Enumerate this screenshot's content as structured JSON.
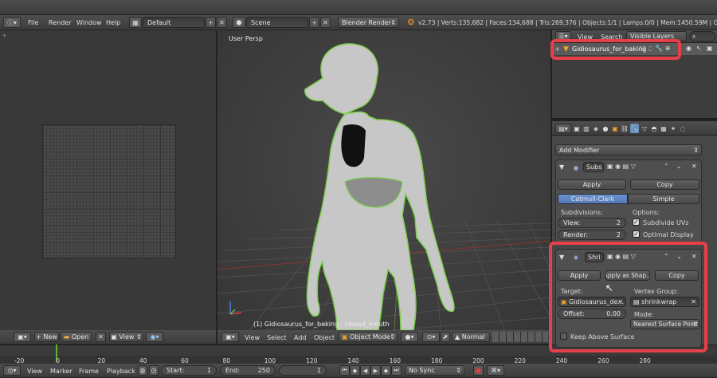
{
  "topbar": {
    "menus": [
      "File",
      "Render",
      "Window",
      "Help"
    ],
    "layout": "Default",
    "scene": "Scene",
    "engine": "Blender Render",
    "stats": "v2.73 | Verts:135,682 | Faces:134,688 | Tris:269,376 | Objects:1/1 | Lamps:0/0 | Mem:1450.59M | Gidiosaurus_"
  },
  "uv_editor": {
    "new_label": "New",
    "open_label": "Open",
    "view_label": "View"
  },
  "viewport": {
    "view_name": "User Persp",
    "object_info": "(1) Gidiosaurus_for_baking : closed_mouth",
    "menus": [
      "View",
      "Select",
      "Add",
      "Object"
    ],
    "mode": "Object Mode",
    "shading": "Normal"
  },
  "outliner": {
    "view_label": "View",
    "search_label": "Search",
    "filter": "Visible Layers",
    "object_name": "Gidiosaurus_for_baking"
  },
  "modifiers": {
    "add_modifier": "Add Modifier",
    "subsurf": {
      "name": "Subs",
      "apply": "Apply",
      "copy": "Copy",
      "type_options": [
        "Catmull-Clark",
        "Simple"
      ],
      "selected_type": "Catmull-Clark",
      "subdivisions_label": "Subdivisions:",
      "view_label": "View:",
      "view_value": "2",
      "render_label": "Render:",
      "render_value": "2",
      "options_label": "Options:",
      "subdivide_uvs": "Subdivide UVs",
      "optimal_display": "Optimal Display"
    },
    "shrinkwrap": {
      "name": "Shri",
      "apply": "Apply",
      "apply_shape": "Apply as Shap...",
      "copy": "Copy",
      "target_label": "Target:",
      "target_value": "Gidiosaurus_de...",
      "vertex_group_label": "Vertex Group:",
      "vertex_group_value": "shrinkwrap",
      "offset_label": "Offset:",
      "offset_value": "0.00",
      "mode_label": "Mode:",
      "mode_value": "Nearest Surface Point",
      "keep_above": "Keep Above Surface"
    }
  },
  "timeline": {
    "ticks": [
      "-20",
      "0",
      "20",
      "40",
      "60",
      "80",
      "100",
      "120",
      "140",
      "160",
      "180",
      "200",
      "220",
      "240",
      "260",
      "280"
    ],
    "menus": [
      "View",
      "Marker",
      "Frame",
      "Playback"
    ],
    "start_label": "Start:",
    "start_value": "1",
    "end_label": "End:",
    "end_value": "250",
    "current_frame": "1",
    "sync": "No Sync"
  }
}
